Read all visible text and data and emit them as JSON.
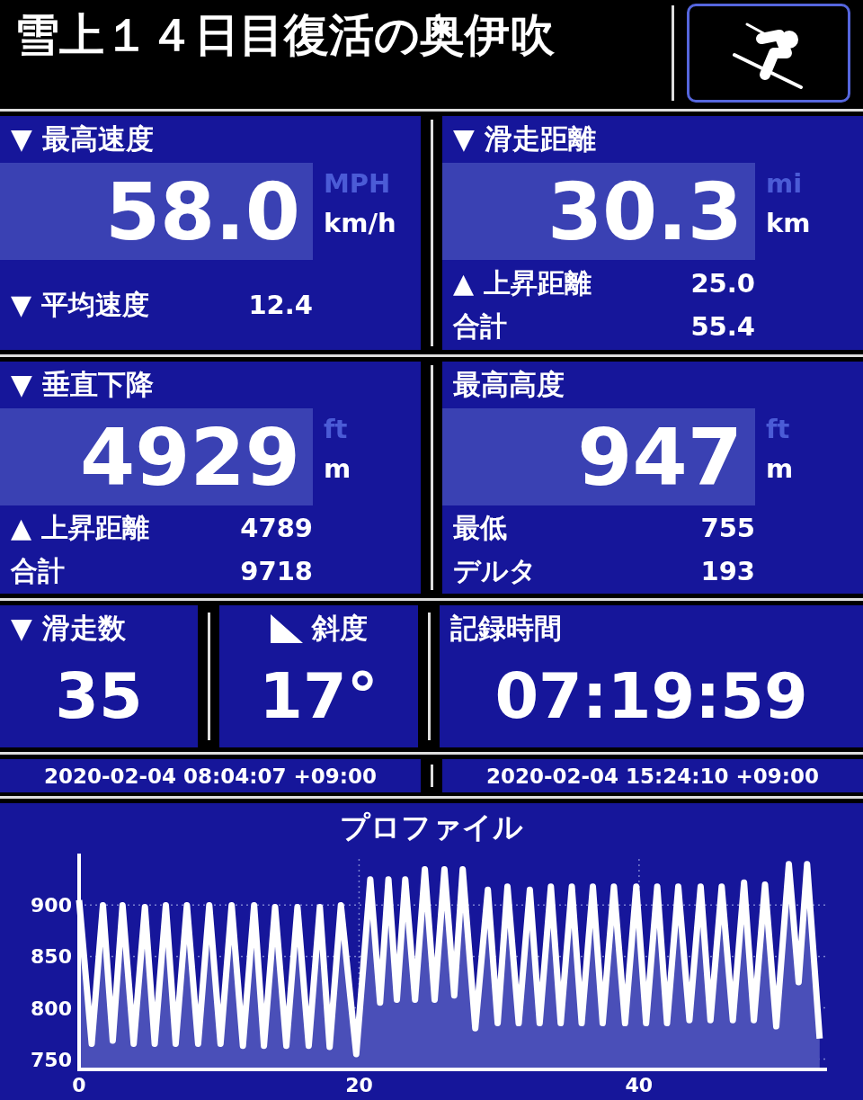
{
  "header": {
    "title": "雪上１４日目復活の奥伊吹"
  },
  "stat_panels": [
    {
      "label": "▼ 最高速度",
      "value": "58.0",
      "units": [
        {
          "label": "MPH",
          "selected": false
        },
        {
          "label": "km/h",
          "selected": true
        }
      ],
      "details": [
        {
          "label": "▼ 平均速度",
          "value": "12.4"
        }
      ]
    },
    {
      "label": "▼ 滑走距離",
      "value": "30.3",
      "units": [
        {
          "label": "mi",
          "selected": false
        },
        {
          "label": "km",
          "selected": true
        }
      ],
      "details": [
        {
          "label": "▲ 上昇距離",
          "value": "25.0"
        },
        {
          "label": "合計",
          "value": "55.4"
        }
      ]
    },
    {
      "label": "▼ 垂直下降",
      "value": "4929",
      "units": [
        {
          "label": "ft",
          "selected": false
        },
        {
          "label": "m",
          "selected": true
        }
      ],
      "details": [
        {
          "label": "▲ 上昇距離",
          "value": "4789"
        },
        {
          "label": "合計",
          "value": "9718"
        }
      ]
    },
    {
      "label": "最高高度",
      "value": "947",
      "units": [
        {
          "label": "ft",
          "selected": false
        },
        {
          "label": "m",
          "selected": true
        }
      ],
      "details": [
        {
          "label": "最低",
          "value": "755"
        },
        {
          "label": "デルタ",
          "value": "193"
        }
      ]
    }
  ],
  "counter_panels": [
    {
      "kind": "plain",
      "label": "▼ 滑走数",
      "value": "35"
    },
    {
      "kind": "slope",
      "label": "斜度",
      "value": "17°"
    },
    {
      "kind": "plain",
      "label": "記録時間",
      "value": "07:19:59"
    }
  ],
  "time_range": [
    "2020-02-04 08:04:07 +09:00",
    "2020-02-04 15:24:10 +09:00"
  ],
  "profile": {
    "chart_data": {
      "type": "area",
      "title": "プロファイル",
      "x": [
        0,
        0.9,
        1.7,
        2.4,
        3.1,
        3.9,
        4.7,
        5.4,
        6.2,
        6.9,
        7.7,
        8.5,
        9.3,
        10.1,
        10.9,
        11.7,
        12.5,
        13.2,
        14.0,
        14.8,
        15.6,
        16.4,
        17.2,
        17.9,
        18.7,
        19.8,
        20.8,
        21.5,
        22.1,
        22.7,
        23.3,
        24.0,
        24.7,
        25.4,
        26.1,
        26.8,
        27.4,
        28.3,
        29.2,
        29.9,
        30.6,
        31.4,
        32.2,
        32.9,
        33.7,
        34.4,
        35.2,
        35.9,
        36.7,
        37.4,
        38.2,
        39.0,
        39.8,
        40.5,
        41.3,
        42.0,
        42.8,
        43.6,
        44.4,
        45.1,
        45.9,
        46.7,
        47.5,
        48.2,
        49.0,
        49.8,
        50.7,
        51.4,
        52.0,
        52.9
      ],
      "series": [
        {
          "values": [
            905,
            765,
            900,
            768,
            900,
            765,
            898,
            765,
            900,
            765,
            900,
            765,
            900,
            765,
            900,
            763,
            900,
            763,
            898,
            763,
            898,
            763,
            898,
            762,
            900,
            755,
            925,
            805,
            925,
            808,
            925,
            808,
            935,
            808,
            935,
            812,
            935,
            780,
            915,
            785,
            918,
            785,
            915,
            785,
            918,
            785,
            918,
            785,
            918,
            785,
            918,
            785,
            918,
            785,
            918,
            785,
            918,
            788,
            918,
            788,
            918,
            788,
            922,
            788,
            920,
            782,
            940,
            825,
            940,
            770
          ]
        }
      ],
      "grid": true,
      "xlim": [
        0,
        53.3
      ],
      "ylim": [
        740,
        945
      ],
      "xticks": [
        0,
        20,
        40
      ],
      "yticks": [
        750,
        800,
        850,
        900
      ]
    }
  }
}
